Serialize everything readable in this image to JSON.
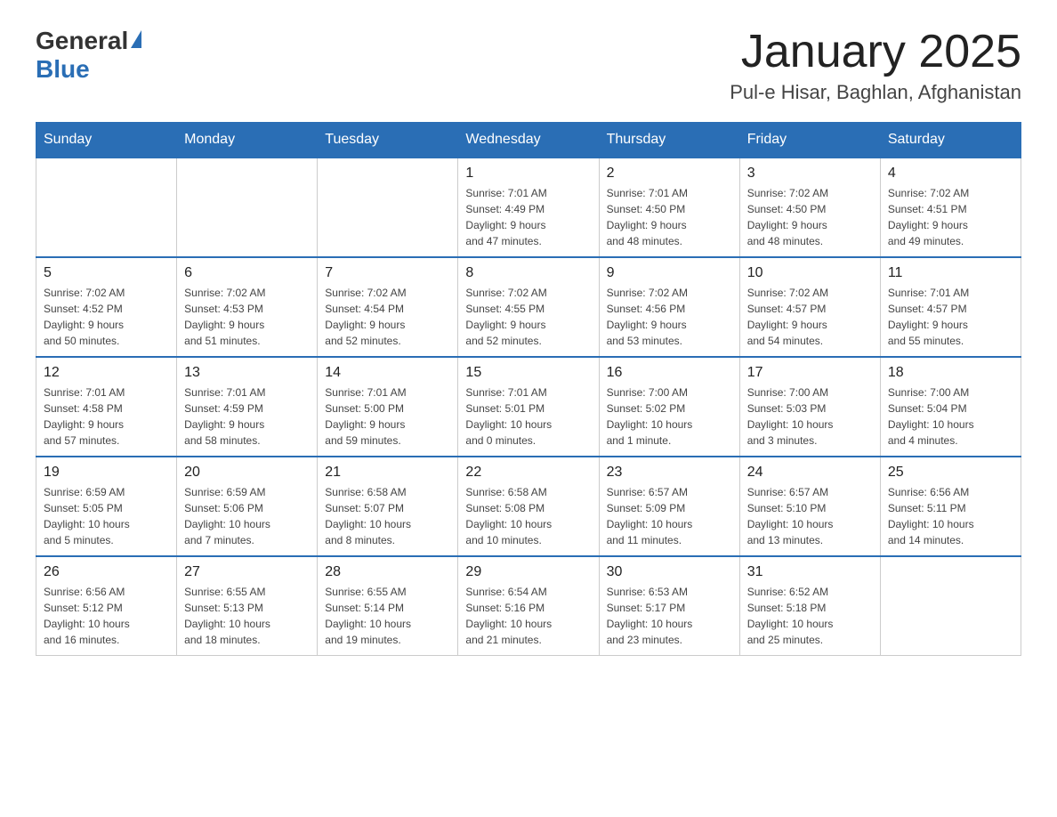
{
  "header": {
    "logo_general": "General",
    "logo_blue": "Blue",
    "title": "January 2025",
    "subtitle": "Pul-e Hisar, Baghlan, Afghanistan"
  },
  "weekdays": [
    "Sunday",
    "Monday",
    "Tuesday",
    "Wednesday",
    "Thursday",
    "Friday",
    "Saturday"
  ],
  "weeks": [
    [
      {
        "day": "",
        "info": ""
      },
      {
        "day": "",
        "info": ""
      },
      {
        "day": "",
        "info": ""
      },
      {
        "day": "1",
        "info": "Sunrise: 7:01 AM\nSunset: 4:49 PM\nDaylight: 9 hours\nand 47 minutes."
      },
      {
        "day": "2",
        "info": "Sunrise: 7:01 AM\nSunset: 4:50 PM\nDaylight: 9 hours\nand 48 minutes."
      },
      {
        "day": "3",
        "info": "Sunrise: 7:02 AM\nSunset: 4:50 PM\nDaylight: 9 hours\nand 48 minutes."
      },
      {
        "day": "4",
        "info": "Sunrise: 7:02 AM\nSunset: 4:51 PM\nDaylight: 9 hours\nand 49 minutes."
      }
    ],
    [
      {
        "day": "5",
        "info": "Sunrise: 7:02 AM\nSunset: 4:52 PM\nDaylight: 9 hours\nand 50 minutes."
      },
      {
        "day": "6",
        "info": "Sunrise: 7:02 AM\nSunset: 4:53 PM\nDaylight: 9 hours\nand 51 minutes."
      },
      {
        "day": "7",
        "info": "Sunrise: 7:02 AM\nSunset: 4:54 PM\nDaylight: 9 hours\nand 52 minutes."
      },
      {
        "day": "8",
        "info": "Sunrise: 7:02 AM\nSunset: 4:55 PM\nDaylight: 9 hours\nand 52 minutes."
      },
      {
        "day": "9",
        "info": "Sunrise: 7:02 AM\nSunset: 4:56 PM\nDaylight: 9 hours\nand 53 minutes."
      },
      {
        "day": "10",
        "info": "Sunrise: 7:02 AM\nSunset: 4:57 PM\nDaylight: 9 hours\nand 54 minutes."
      },
      {
        "day": "11",
        "info": "Sunrise: 7:01 AM\nSunset: 4:57 PM\nDaylight: 9 hours\nand 55 minutes."
      }
    ],
    [
      {
        "day": "12",
        "info": "Sunrise: 7:01 AM\nSunset: 4:58 PM\nDaylight: 9 hours\nand 57 minutes."
      },
      {
        "day": "13",
        "info": "Sunrise: 7:01 AM\nSunset: 4:59 PM\nDaylight: 9 hours\nand 58 minutes."
      },
      {
        "day": "14",
        "info": "Sunrise: 7:01 AM\nSunset: 5:00 PM\nDaylight: 9 hours\nand 59 minutes."
      },
      {
        "day": "15",
        "info": "Sunrise: 7:01 AM\nSunset: 5:01 PM\nDaylight: 10 hours\nand 0 minutes."
      },
      {
        "day": "16",
        "info": "Sunrise: 7:00 AM\nSunset: 5:02 PM\nDaylight: 10 hours\nand 1 minute."
      },
      {
        "day": "17",
        "info": "Sunrise: 7:00 AM\nSunset: 5:03 PM\nDaylight: 10 hours\nand 3 minutes."
      },
      {
        "day": "18",
        "info": "Sunrise: 7:00 AM\nSunset: 5:04 PM\nDaylight: 10 hours\nand 4 minutes."
      }
    ],
    [
      {
        "day": "19",
        "info": "Sunrise: 6:59 AM\nSunset: 5:05 PM\nDaylight: 10 hours\nand 5 minutes."
      },
      {
        "day": "20",
        "info": "Sunrise: 6:59 AM\nSunset: 5:06 PM\nDaylight: 10 hours\nand 7 minutes."
      },
      {
        "day": "21",
        "info": "Sunrise: 6:58 AM\nSunset: 5:07 PM\nDaylight: 10 hours\nand 8 minutes."
      },
      {
        "day": "22",
        "info": "Sunrise: 6:58 AM\nSunset: 5:08 PM\nDaylight: 10 hours\nand 10 minutes."
      },
      {
        "day": "23",
        "info": "Sunrise: 6:57 AM\nSunset: 5:09 PM\nDaylight: 10 hours\nand 11 minutes."
      },
      {
        "day": "24",
        "info": "Sunrise: 6:57 AM\nSunset: 5:10 PM\nDaylight: 10 hours\nand 13 minutes."
      },
      {
        "day": "25",
        "info": "Sunrise: 6:56 AM\nSunset: 5:11 PM\nDaylight: 10 hours\nand 14 minutes."
      }
    ],
    [
      {
        "day": "26",
        "info": "Sunrise: 6:56 AM\nSunset: 5:12 PM\nDaylight: 10 hours\nand 16 minutes."
      },
      {
        "day": "27",
        "info": "Sunrise: 6:55 AM\nSunset: 5:13 PM\nDaylight: 10 hours\nand 18 minutes."
      },
      {
        "day": "28",
        "info": "Sunrise: 6:55 AM\nSunset: 5:14 PM\nDaylight: 10 hours\nand 19 minutes."
      },
      {
        "day": "29",
        "info": "Sunrise: 6:54 AM\nSunset: 5:16 PM\nDaylight: 10 hours\nand 21 minutes."
      },
      {
        "day": "30",
        "info": "Sunrise: 6:53 AM\nSunset: 5:17 PM\nDaylight: 10 hours\nand 23 minutes."
      },
      {
        "day": "31",
        "info": "Sunrise: 6:52 AM\nSunset: 5:18 PM\nDaylight: 10 hours\nand 25 minutes."
      },
      {
        "day": "",
        "info": ""
      }
    ]
  ]
}
